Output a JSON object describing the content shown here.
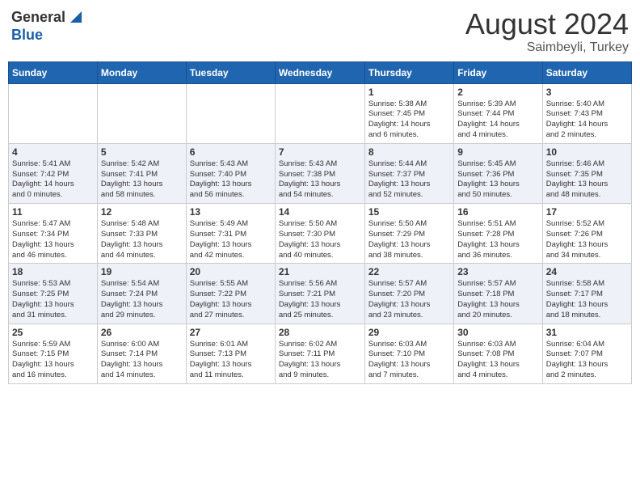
{
  "header": {
    "logo_general": "General",
    "logo_blue": "Blue",
    "title": "August 2024",
    "location": "Saimbeyli, Turkey"
  },
  "days_of_week": [
    "Sunday",
    "Monday",
    "Tuesday",
    "Wednesday",
    "Thursday",
    "Friday",
    "Saturday"
  ],
  "weeks": [
    [
      {
        "day": "",
        "info": ""
      },
      {
        "day": "",
        "info": ""
      },
      {
        "day": "",
        "info": ""
      },
      {
        "day": "",
        "info": ""
      },
      {
        "day": "1",
        "info": "Sunrise: 5:38 AM\nSunset: 7:45 PM\nDaylight: 14 hours\nand 6 minutes."
      },
      {
        "day": "2",
        "info": "Sunrise: 5:39 AM\nSunset: 7:44 PM\nDaylight: 14 hours\nand 4 minutes."
      },
      {
        "day": "3",
        "info": "Sunrise: 5:40 AM\nSunset: 7:43 PM\nDaylight: 14 hours\nand 2 minutes."
      }
    ],
    [
      {
        "day": "4",
        "info": "Sunrise: 5:41 AM\nSunset: 7:42 PM\nDaylight: 14 hours\nand 0 minutes."
      },
      {
        "day": "5",
        "info": "Sunrise: 5:42 AM\nSunset: 7:41 PM\nDaylight: 13 hours\nand 58 minutes."
      },
      {
        "day": "6",
        "info": "Sunrise: 5:43 AM\nSunset: 7:40 PM\nDaylight: 13 hours\nand 56 minutes."
      },
      {
        "day": "7",
        "info": "Sunrise: 5:43 AM\nSunset: 7:38 PM\nDaylight: 13 hours\nand 54 minutes."
      },
      {
        "day": "8",
        "info": "Sunrise: 5:44 AM\nSunset: 7:37 PM\nDaylight: 13 hours\nand 52 minutes."
      },
      {
        "day": "9",
        "info": "Sunrise: 5:45 AM\nSunset: 7:36 PM\nDaylight: 13 hours\nand 50 minutes."
      },
      {
        "day": "10",
        "info": "Sunrise: 5:46 AM\nSunset: 7:35 PM\nDaylight: 13 hours\nand 48 minutes."
      }
    ],
    [
      {
        "day": "11",
        "info": "Sunrise: 5:47 AM\nSunset: 7:34 PM\nDaylight: 13 hours\nand 46 minutes."
      },
      {
        "day": "12",
        "info": "Sunrise: 5:48 AM\nSunset: 7:33 PM\nDaylight: 13 hours\nand 44 minutes."
      },
      {
        "day": "13",
        "info": "Sunrise: 5:49 AM\nSunset: 7:31 PM\nDaylight: 13 hours\nand 42 minutes."
      },
      {
        "day": "14",
        "info": "Sunrise: 5:50 AM\nSunset: 7:30 PM\nDaylight: 13 hours\nand 40 minutes."
      },
      {
        "day": "15",
        "info": "Sunrise: 5:50 AM\nSunset: 7:29 PM\nDaylight: 13 hours\nand 38 minutes."
      },
      {
        "day": "16",
        "info": "Sunrise: 5:51 AM\nSunset: 7:28 PM\nDaylight: 13 hours\nand 36 minutes."
      },
      {
        "day": "17",
        "info": "Sunrise: 5:52 AM\nSunset: 7:26 PM\nDaylight: 13 hours\nand 34 minutes."
      }
    ],
    [
      {
        "day": "18",
        "info": "Sunrise: 5:53 AM\nSunset: 7:25 PM\nDaylight: 13 hours\nand 31 minutes."
      },
      {
        "day": "19",
        "info": "Sunrise: 5:54 AM\nSunset: 7:24 PM\nDaylight: 13 hours\nand 29 minutes."
      },
      {
        "day": "20",
        "info": "Sunrise: 5:55 AM\nSunset: 7:22 PM\nDaylight: 13 hours\nand 27 minutes."
      },
      {
        "day": "21",
        "info": "Sunrise: 5:56 AM\nSunset: 7:21 PM\nDaylight: 13 hours\nand 25 minutes."
      },
      {
        "day": "22",
        "info": "Sunrise: 5:57 AM\nSunset: 7:20 PM\nDaylight: 13 hours\nand 23 minutes."
      },
      {
        "day": "23",
        "info": "Sunrise: 5:57 AM\nSunset: 7:18 PM\nDaylight: 13 hours\nand 20 minutes."
      },
      {
        "day": "24",
        "info": "Sunrise: 5:58 AM\nSunset: 7:17 PM\nDaylight: 13 hours\nand 18 minutes."
      }
    ],
    [
      {
        "day": "25",
        "info": "Sunrise: 5:59 AM\nSunset: 7:15 PM\nDaylight: 13 hours\nand 16 minutes."
      },
      {
        "day": "26",
        "info": "Sunrise: 6:00 AM\nSunset: 7:14 PM\nDaylight: 13 hours\nand 14 minutes."
      },
      {
        "day": "27",
        "info": "Sunrise: 6:01 AM\nSunset: 7:13 PM\nDaylight: 13 hours\nand 11 minutes."
      },
      {
        "day": "28",
        "info": "Sunrise: 6:02 AM\nSunset: 7:11 PM\nDaylight: 13 hours\nand 9 minutes."
      },
      {
        "day": "29",
        "info": "Sunrise: 6:03 AM\nSunset: 7:10 PM\nDaylight: 13 hours\nand 7 minutes."
      },
      {
        "day": "30",
        "info": "Sunrise: 6:03 AM\nSunset: 7:08 PM\nDaylight: 13 hours\nand 4 minutes."
      },
      {
        "day": "31",
        "info": "Sunrise: 6:04 AM\nSunset: 7:07 PM\nDaylight: 13 hours\nand 2 minutes."
      }
    ]
  ]
}
